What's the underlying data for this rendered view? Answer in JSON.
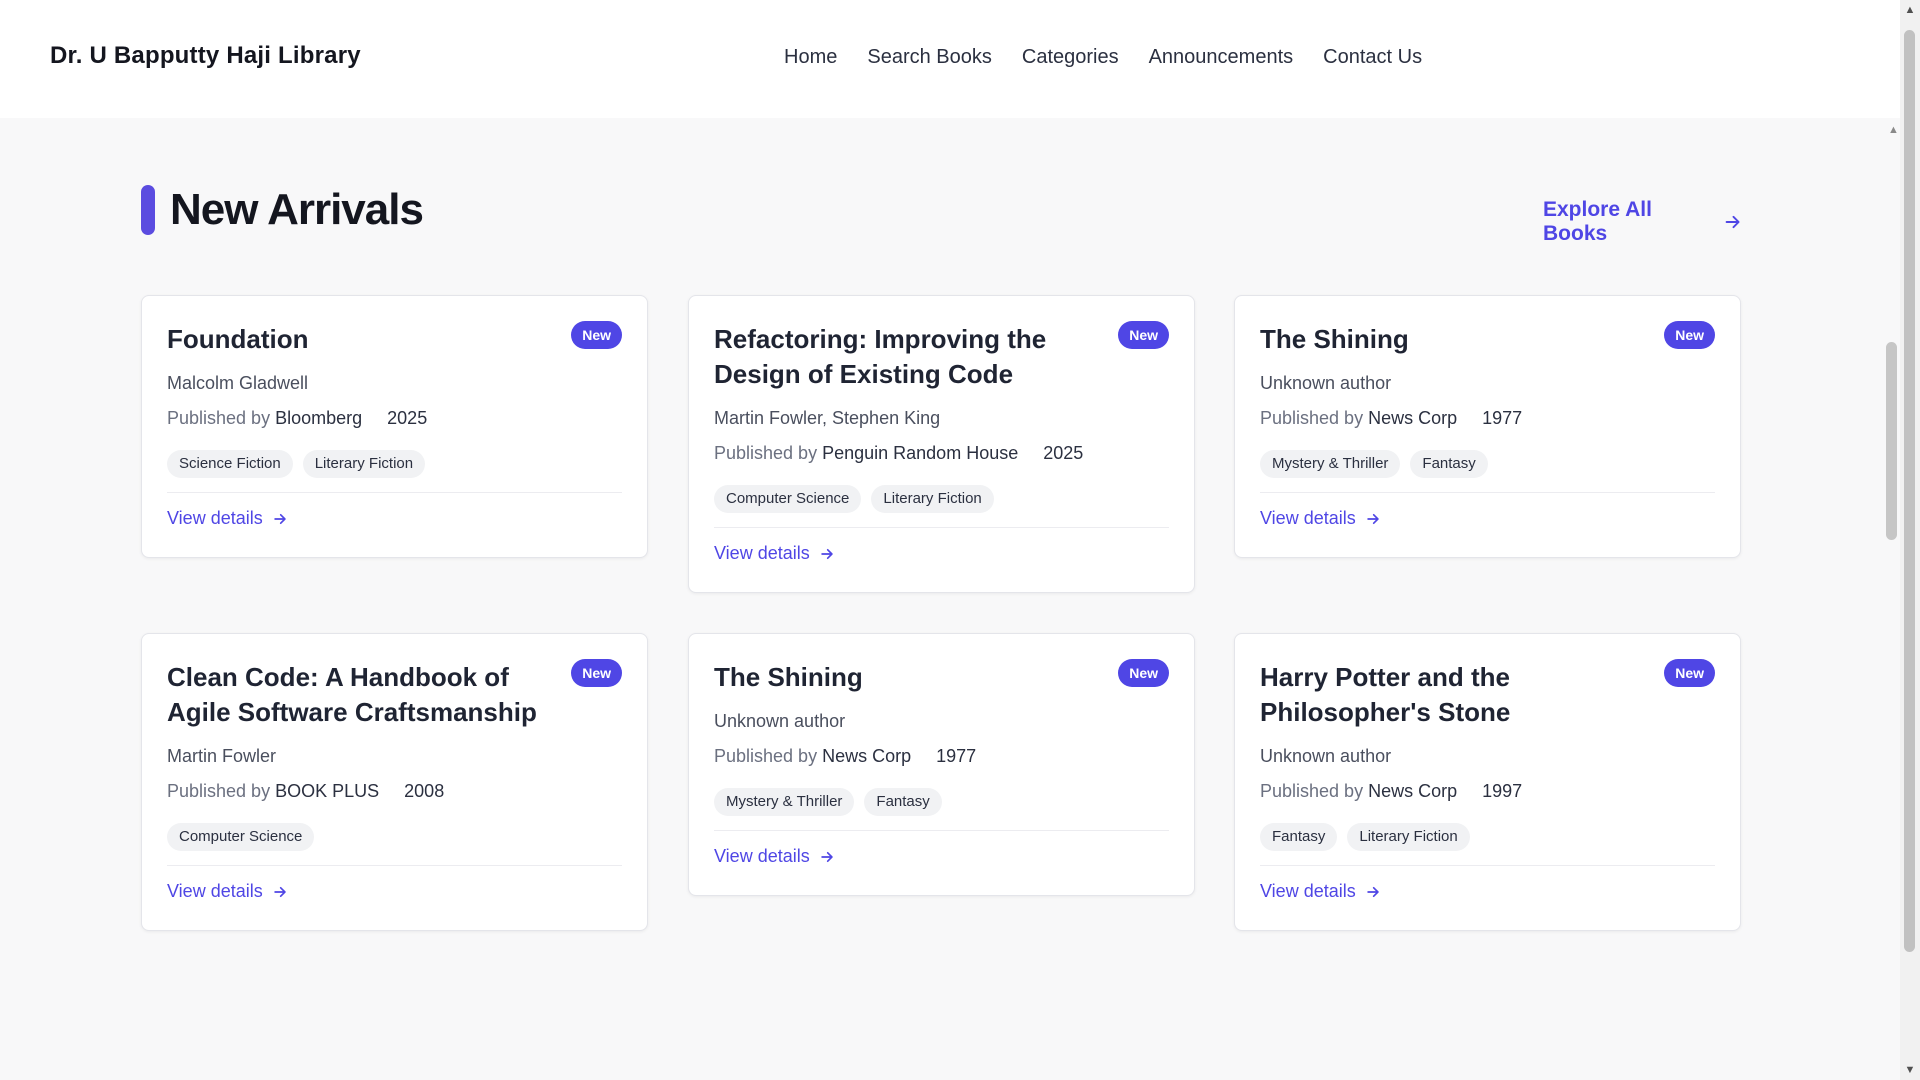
{
  "header": {
    "brand": "Dr. U Bapputty Haji Library",
    "nav": [
      "Home",
      "Search Books",
      "Categories",
      "Announcements",
      "Contact Us"
    ]
  },
  "section": {
    "title": "New Arrivals",
    "explore_label": "Explore All Books",
    "accent_color": "#5b4ce0"
  },
  "common": {
    "badge": "New",
    "published_by": "Published by",
    "view_details": "View details"
  },
  "books": [
    {
      "title": "Foundation",
      "author": "Malcolm Gladwell",
      "publisher": "Bloomberg",
      "year": "2025",
      "tags": [
        "Science Fiction",
        "Literary Fiction"
      ]
    },
    {
      "title": "Refactoring: Improving the Design of Existing Code",
      "author": "Martin Fowler, Stephen King",
      "publisher": "Penguin Random House",
      "year": "2025",
      "tags": [
        "Computer Science",
        "Literary Fiction"
      ]
    },
    {
      "title": "The Shining",
      "author": "Unknown author",
      "publisher": "News Corp",
      "year": "1977",
      "tags": [
        "Mystery & Thriller",
        "Fantasy"
      ]
    },
    {
      "title": "Clean Code: A Handbook of Agile Software Craftsmanship",
      "author": "Martin Fowler",
      "publisher": "BOOK PLUS",
      "year": "2008",
      "tags": [
        "Computer Science"
      ]
    },
    {
      "title": "The Shining",
      "author": "Unknown author",
      "publisher": "News Corp",
      "year": "1977",
      "tags": [
        "Mystery & Thriller",
        "Fantasy"
      ]
    },
    {
      "title": "Harry Potter and the Philosopher's Stone",
      "author": "Unknown author",
      "publisher": "News Corp",
      "year": "1997",
      "tags": [
        "Fantasy",
        "Literary Fiction"
      ]
    }
  ],
  "icons": {
    "explore_arrow": "arrow-right-icon",
    "view_arrow": "arrow-right-icon"
  },
  "colors": {
    "accent": "#4f46e5",
    "background": "#f8f8f9"
  }
}
